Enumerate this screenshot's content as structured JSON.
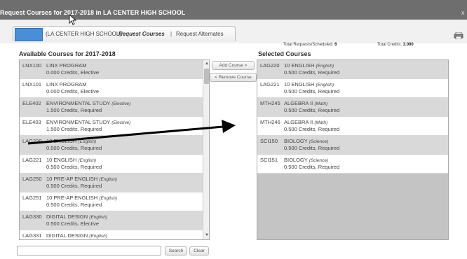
{
  "window": {
    "title": "Request Courses for 2017-2018 in LA CENTER HIGH SCHOOL",
    "close": "x"
  },
  "tab": {
    "school": "(LA CENTER HIGH SCHOOL)",
    "request_courses": "Request Courses",
    "separator": "|",
    "request_alternates": "Request Alternates"
  },
  "totals": {
    "requests_label": "Total Requests/Scheduled:",
    "requests_value": "6",
    "credits_label": "Total Credits:",
    "credits_value": "3.000"
  },
  "available": {
    "heading": "Available Courses for 2017-2018",
    "courses": [
      {
        "code": "LNX100",
        "name": "LINX PROGRAM",
        "subject": "",
        "credits": "0.000 Credits,  Elective"
      },
      {
        "code": "LNX101",
        "name": "LINX PROGRAM",
        "subject": "",
        "credits": "0.000 Credits,  Elective"
      },
      {
        "code": "ELE402",
        "name": "ENVIRONMENTAL STUDY",
        "subject": "(Elective)",
        "credits": "1.500 Credits,  Required"
      },
      {
        "code": "ELE403",
        "name": "ENVIRONMENTAL STUDY",
        "subject": "(Elective)",
        "credits": "1.500 Credits,  Required"
      },
      {
        "code": "LAG220",
        "name": "10 ENGLISH",
        "subject": "(English)",
        "credits": "0.500 Credits,  Required"
      },
      {
        "code": "LAG221",
        "name": "10 ENGLISH",
        "subject": "(English)",
        "credits": "0.500 Credits,  Required"
      },
      {
        "code": "LAG250",
        "name": "10 PRE-AP ENGLISH",
        "subject": "(English)",
        "credits": "0.500 Credits,  Required"
      },
      {
        "code": "LAG251",
        "name": "10 PRE-AP ENGLISH",
        "subject": "(English)",
        "credits": "0.500 Credits,  Required"
      },
      {
        "code": "LAG330",
        "name": "DIGITAL DESIGN",
        "subject": "(English)",
        "credits": "0.500 Credits,  Elective"
      },
      {
        "code": "LAG331",
        "name": "DIGITAL DESIGN",
        "subject": "(English)",
        "credits": ""
      }
    ]
  },
  "actions": {
    "add_course": "Add Course >",
    "remove_course": "< Remove Course"
  },
  "selected": {
    "heading": "Selected Courses",
    "courses": [
      {
        "code": "LAG220",
        "name": "10 ENGLISH",
        "subject": "(English)",
        "credits": "0.500 Credits,  Required"
      },
      {
        "code": "LAG221",
        "name": "10 ENGLISH",
        "subject": "(English)",
        "credits": "0.500 Credits,  Required"
      },
      {
        "code": "MTH245",
        "name": "ALGEBRA II",
        "subject": "(Math)",
        "credits": "0.500 Credits,  Required"
      },
      {
        "code": "MTH246",
        "name": "ALGEBRA II",
        "subject": "(Math)",
        "credits": "0.500 Credits,  Required"
      },
      {
        "code": "SCI150",
        "name": "BIOLOGY",
        "subject": "(Science)",
        "credits": "0.500 Credits,  Required"
      },
      {
        "code": "SCI151",
        "name": "BIOLOGY",
        "subject": "(Science)",
        "credits": "0.500 Credits,  Required"
      }
    ]
  },
  "search": {
    "value": "",
    "button": "Search",
    "clear": "Clear"
  },
  "colors": {
    "titlebar": "#6e6e6e",
    "tab_highlight": "#4a8ed8",
    "row_shade": "#d9d9d9",
    "empty_area": "#c4c4c4"
  },
  "icons": {
    "close": "close-icon",
    "printer": "printer-icon",
    "cursor": "mouse-cursor-icon",
    "arrow": "annotation-arrow-icon"
  }
}
